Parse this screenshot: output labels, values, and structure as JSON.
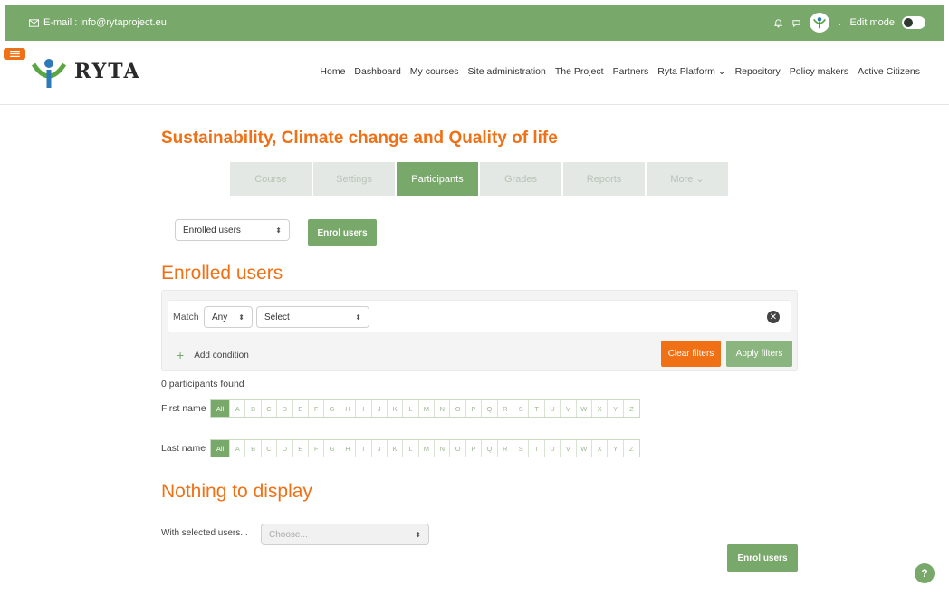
{
  "topbar": {
    "email": "E-mail : info@rytaproject.eu",
    "edit_mode": "Edit mode"
  },
  "logo": {
    "text": "RYTA"
  },
  "nav": {
    "items": [
      "Home",
      "Dashboard",
      "My courses",
      "Site administration",
      "The Project",
      "Partners",
      "Ryta Platform ⌄",
      "Repository",
      "Policy makers",
      "Active Citizens"
    ]
  },
  "course": {
    "title": "Sustainability, Climate change and Quality of life"
  },
  "tabs": [
    "Course",
    "Settings",
    "Participants",
    "Grades",
    "Reports",
    "More ⌄"
  ],
  "participants_nav": {
    "select_value": "Enrolled users",
    "enrol_button": "Enrol users"
  },
  "enrolled": {
    "heading": "Enrolled users"
  },
  "filters": {
    "match_label": "Match",
    "match_value": "Any",
    "select_value": "Select",
    "add_condition": "Add condition",
    "clear_filters": "Clear filters",
    "apply_filters": "Apply filters"
  },
  "results": {
    "found": "0 participants found"
  },
  "initials": {
    "first_name_label": "First name",
    "last_name_label": "Last name",
    "all": "All",
    "letters": [
      "A",
      "B",
      "C",
      "D",
      "E",
      "F",
      "G",
      "H",
      "I",
      "J",
      "K",
      "L",
      "M",
      "N",
      "O",
      "P",
      "Q",
      "R",
      "S",
      "T",
      "U",
      "V",
      "W",
      "X",
      "Y",
      "Z"
    ]
  },
  "empty": {
    "heading": "Nothing to display"
  },
  "bulk": {
    "label": "With selected users...",
    "placeholder": "Choose...",
    "enrol_button": "Enrol users"
  },
  "help": {
    "label": "?"
  },
  "colors": {
    "brand_green": "#78a86a",
    "accent_orange": "#f07016"
  }
}
